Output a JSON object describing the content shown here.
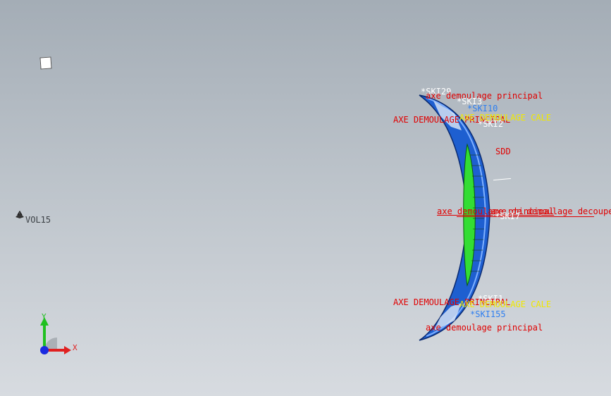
{
  "annotations": {
    "vol15": "VOL15",
    "ski29": "*SKI29",
    "axe_dem_principal_top": "axe demoulage principal",
    "ski_a": "*SKI3",
    "ski_b": "*SKI10",
    "axe_dem_principal_caps_top": "AXE DEMOULAGE PRINCIPAL",
    "axe_dem_cale_top": "AXE DEMOULAGE CALE",
    "ski2": "*SKI2",
    "sdd": "SDD",
    "axe_dem_principal_mid": "axe demoulage principal",
    "axe_dem_decoupes": "axe de demoulage decoupes c",
    "ski7": "*SKI7",
    "ski_c": "*SKI1",
    "axe_dem_principal_caps_bottom": "AXE DEMOULAGE PRINCIPAL",
    "axe_dem_cale_bottom": "AXE DEMOULAGE CALE",
    "ski155": "*SKI155",
    "axe_dem_principal_bottom": "axe demoulage principal"
  },
  "triad": {
    "y": "Y",
    "x": "X"
  },
  "colors": {
    "red": "#e00000",
    "yellow": "#f0e800",
    "blue": "#2f7ff0",
    "part_blue": "#1e5fd0",
    "part_green": "#33dd33",
    "triad_x": "#e02020",
    "triad_y": "#20c020",
    "triad_z": "#1a2ae0"
  }
}
